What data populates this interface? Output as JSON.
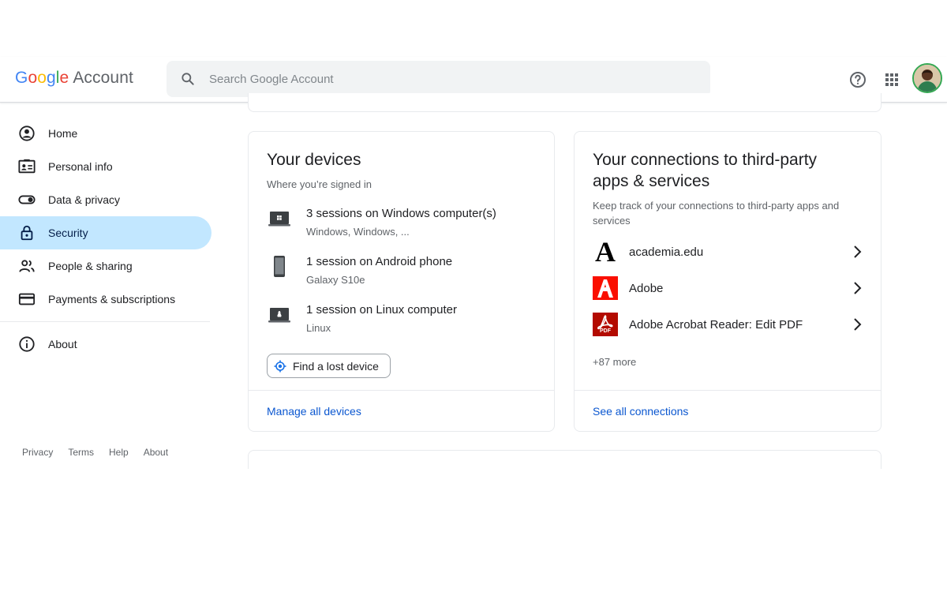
{
  "header": {
    "logo_letters": [
      "G",
      "o",
      "o",
      "g",
      "l",
      "e"
    ],
    "logo_suffix": "Account",
    "search_placeholder": "Search Google Account",
    "icons": [
      "search-icon",
      "help-icon",
      "apps-grid-icon"
    ]
  },
  "sidebar": {
    "items": [
      {
        "label": "Home",
        "icon": "account-circle-icon",
        "active": false
      },
      {
        "label": "Personal info",
        "icon": "id-card-icon",
        "active": false
      },
      {
        "label": "Data & privacy",
        "icon": "toggle-icon",
        "active": false
      },
      {
        "label": "Security",
        "icon": "lock-icon",
        "active": true
      },
      {
        "label": "People & sharing",
        "icon": "people-icon",
        "active": false
      },
      {
        "label": "Payments & subscriptions",
        "icon": "credit-card-icon",
        "active": false
      }
    ],
    "about": {
      "label": "About",
      "icon": "info-icon"
    }
  },
  "footer": {
    "links": [
      "Privacy",
      "Terms",
      "Help",
      "About"
    ]
  },
  "devices_card": {
    "title": "Your devices",
    "subtitle": "Where you’re signed in",
    "devices": [
      {
        "title": "3 sessions on Windows computer(s)",
        "subtitle": "Windows, Windows, ...",
        "icon": "windows-laptop-icon"
      },
      {
        "title": "1 session on Android phone",
        "subtitle": "Galaxy S10e",
        "icon": "phone-icon"
      },
      {
        "title": "1 session on Linux computer",
        "subtitle": "Linux",
        "icon": "linux-laptop-icon"
      }
    ],
    "find_button": "Find a lost device",
    "manage_link": "Manage all devices"
  },
  "connections_card": {
    "title": "Your connections to third-party apps & services",
    "subtitle": "Keep track of your connections to third-party apps and services",
    "apps": [
      {
        "name": "academia.edu",
        "logo": "academia-logo-icon",
        "logo_text": "A"
      },
      {
        "name": "Adobe",
        "logo": "adobe-logo-icon",
        "logo_text": "A"
      },
      {
        "name": "Adobe Acrobat Reader: Edit PDF",
        "logo": "acrobat-logo-icon",
        "logo_text": "PDF"
      }
    ],
    "more": "+87 more",
    "see_all_link": "See all connections"
  },
  "colors": {
    "active_nav_bg": "#c2e7ff",
    "link_blue": "#0b57d0",
    "adobe_red": "#fa0f00",
    "acrobat_red": "#b30b00"
  }
}
